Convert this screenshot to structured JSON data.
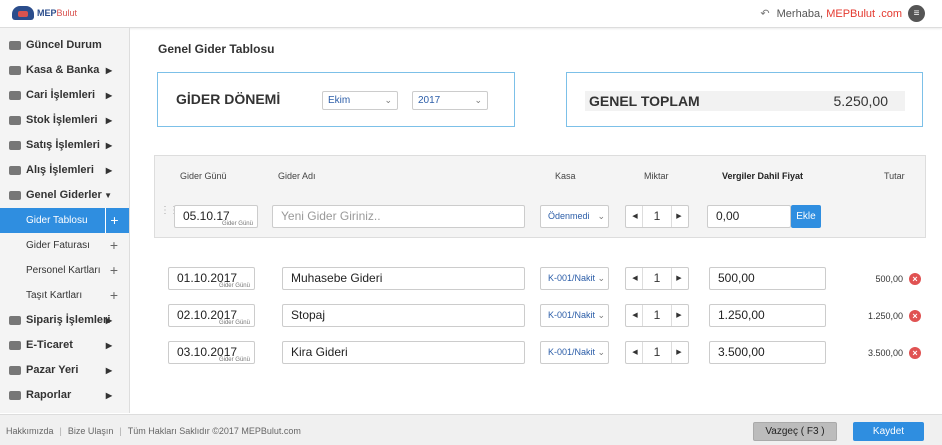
{
  "header": {
    "logo_text_a": "MEP",
    "logo_text_b": "Bulut",
    "greeting": "Merhaba,",
    "brand": "MEPBulut .com",
    "menu_icon": "hamburger-icon"
  },
  "sidebar": {
    "items": [
      {
        "label": "Güncel Durum",
        "icon": "dashboard-icon"
      },
      {
        "label": "Kasa & Banka",
        "icon": "cash-icon"
      },
      {
        "label": "Cari İşlemleri",
        "icon": "contacts-icon"
      },
      {
        "label": "Stok İşlemleri",
        "icon": "box-icon"
      },
      {
        "label": "Satış İşlemleri",
        "icon": "sales-icon"
      },
      {
        "label": "Alış İşlemleri",
        "icon": "purchase-icon"
      },
      {
        "label": "Genel Giderler",
        "icon": "expenses-icon"
      },
      {
        "label": "Sipariş İşlemleri",
        "icon": "order-icon"
      },
      {
        "label": "E-Ticaret",
        "icon": "ecommerce-icon"
      },
      {
        "label": "Pazar Yeri",
        "icon": "marketplace-icon"
      },
      {
        "label": "Raporlar",
        "icon": "reports-icon"
      }
    ],
    "subitems": [
      {
        "label": "Gider Tablosu",
        "active": true
      },
      {
        "label": "Gider Faturası"
      },
      {
        "label": "Personel Kartları"
      },
      {
        "label": "Taşıt Kartları"
      }
    ]
  },
  "page": {
    "title": "Genel Gider Tablosu",
    "period_label": "GİDER DÖNEMİ",
    "month": "Ekim",
    "year": "2017",
    "total_label": "GENEL TOPLAM",
    "total_value": "5.250,00"
  },
  "columns": {
    "date": "Gider Günü",
    "name": "Gider Adı",
    "cash": "Kasa",
    "qty": "Miktar",
    "price": "Vergiler Dahil Fiyat",
    "total": "Tutar"
  },
  "entry": {
    "date": "05.10.17",
    "date_sub": "Gider Günü",
    "name_placeholder": "Yeni Gider Giriniz..",
    "cash": "Ödenmedi",
    "qty": "1",
    "price": "0,00",
    "add_label": "Ekle"
  },
  "rows": [
    {
      "date": "01.10.2017",
      "date_sub": "Gider Günü",
      "name": "Muhasebe Gideri",
      "cash": "K-001/Nakit",
      "qty": "1",
      "price": "500,00",
      "total": "500,00"
    },
    {
      "date": "02.10.2017",
      "date_sub": "Gider Günü",
      "name": "Stopaj",
      "cash": "K-001/Nakit",
      "qty": "1",
      "price": "1.250,00",
      "total": "1.250,00"
    },
    {
      "date": "03.10.2017",
      "date_sub": "Gider Günü",
      "name": "Kira Gideri",
      "cash": "K-001/Nakit",
      "qty": "1",
      "price": "3.500,00",
      "total": "3.500,00"
    }
  ],
  "footer": {
    "link_about": "Hakkımızda",
    "link_contact": "Bize Ulaşın",
    "copyright": "Tüm Hakları Saklıdır ©2017 MEPBulut.com",
    "cancel_label": "Vazgeç ( F3 )",
    "save_label": "Kaydet"
  },
  "colors": {
    "accent": "#2f8ee0",
    "brand_red": "#e4392f",
    "panel_border": "#7cc0e8"
  }
}
